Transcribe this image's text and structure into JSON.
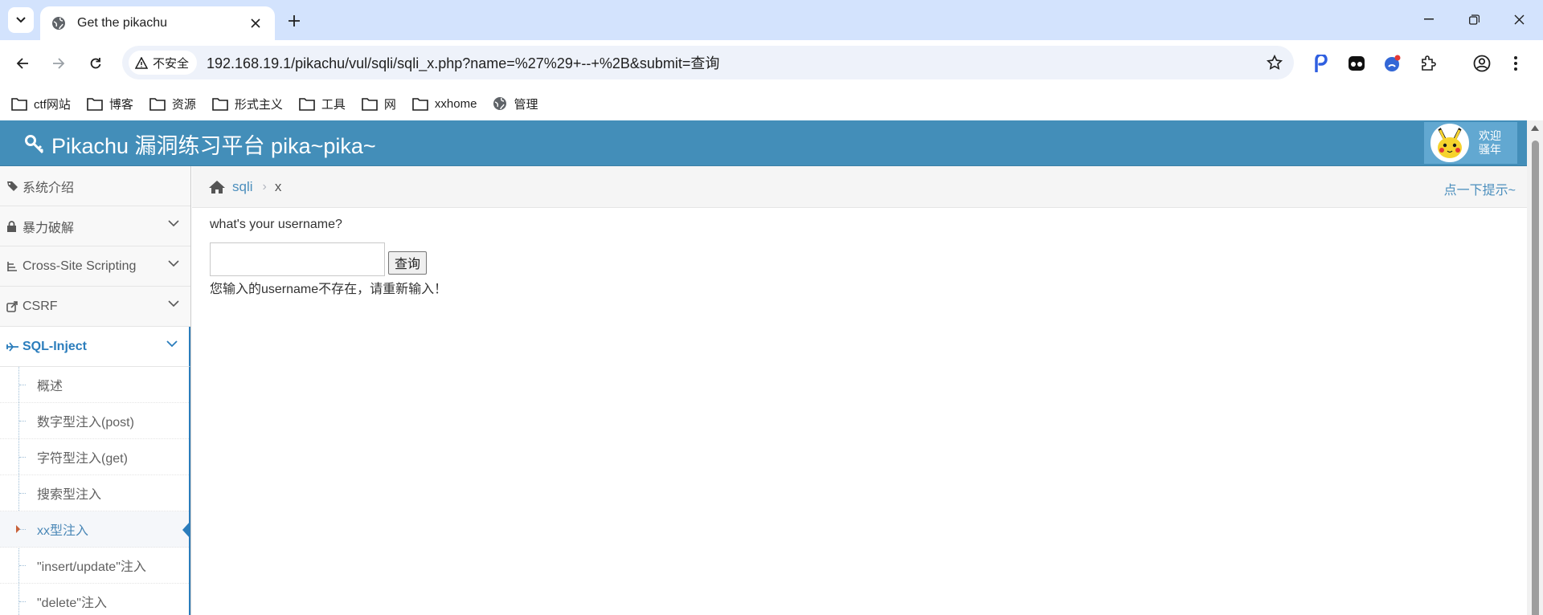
{
  "browser": {
    "tab_title": "Get the pikachu",
    "insecure_label": "不安全",
    "url": "192.168.19.1/pikachu/vul/sqli/sqli_x.php?name=%27%29+--+%2B&submit=查询",
    "bookmarks": [
      {
        "label": "ctf网站",
        "icon": "folder-icon"
      },
      {
        "label": "博客",
        "icon": "folder-icon"
      },
      {
        "label": "资源",
        "icon": "folder-icon"
      },
      {
        "label": "形式主义",
        "icon": "folder-icon"
      },
      {
        "label": "工具",
        "icon": "folder-icon"
      },
      {
        "label": "网",
        "icon": "folder-icon"
      },
      {
        "label": "xxhome",
        "icon": "folder-icon"
      },
      {
        "label": "管理",
        "icon": "globe-icon"
      }
    ]
  },
  "header": {
    "title": "Pikachu 漏洞练习平台 pika~pika~",
    "welcome_line1": "欢迎",
    "welcome_line2": "骚年"
  },
  "sidebar": {
    "items": [
      {
        "label": "系统介绍",
        "icon": "tags-icon"
      },
      {
        "label": "暴力破解",
        "icon": "lock-icon"
      },
      {
        "label": "Cross-Site Scripting",
        "icon": "list-icon"
      },
      {
        "label": "CSRF",
        "icon": "share-icon"
      },
      {
        "label": "SQL-Inject",
        "icon": "fighter-jet-icon"
      }
    ],
    "sub_items": [
      "概述",
      "数字型注入(post)",
      "字符型注入(get)",
      "搜索型注入",
      "xx型注入",
      "\"insert/update\"注入",
      "\"delete\"注入"
    ]
  },
  "breadcrumb": {
    "link": "sqli",
    "current": "x",
    "hint": "点一下提示~"
  },
  "content": {
    "question": "what's your username?",
    "input_value": "",
    "submit_label": "查询",
    "message": "您输入的username不存在，请重新输入！"
  },
  "colors": {
    "header_bg": "#438eb9",
    "accent": "#2b7dbc",
    "browser_frame": "#d3e3fd"
  }
}
